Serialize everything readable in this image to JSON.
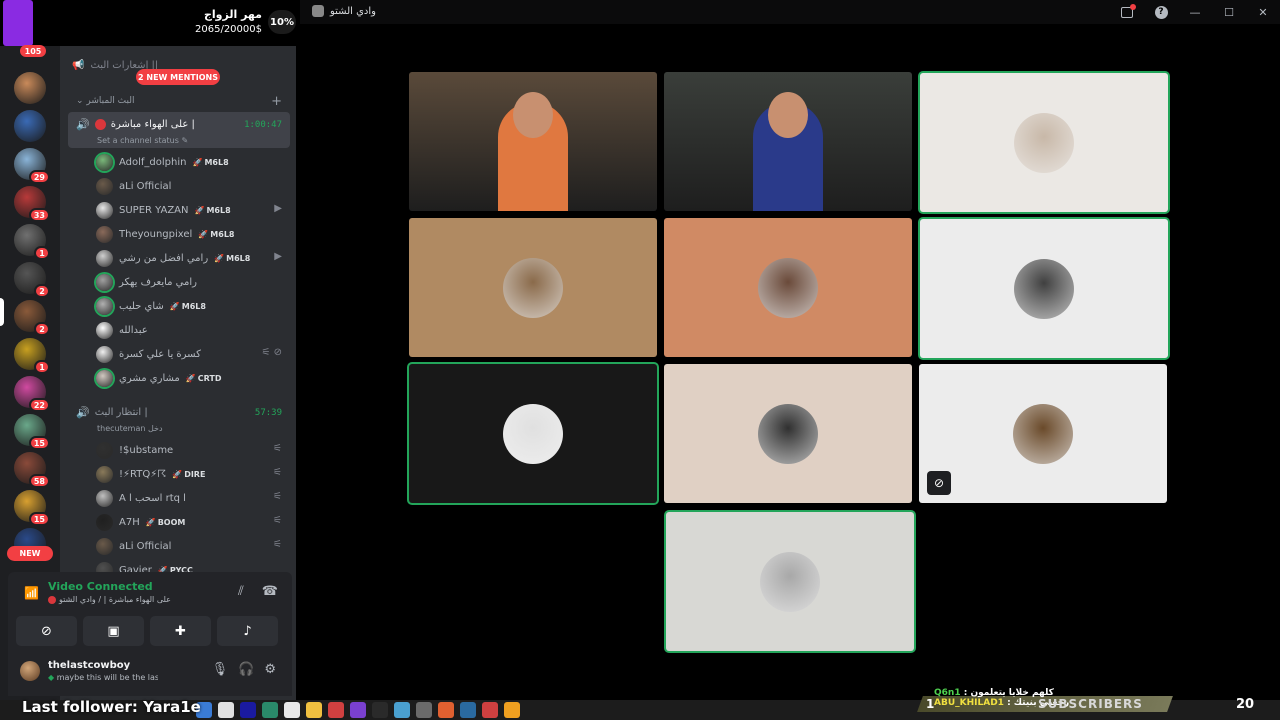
{
  "window": {
    "title": "وادي الشتو"
  },
  "donation": {
    "title": "مهر الزواج",
    "amount": "2065/20000$",
    "percent": "10%"
  },
  "rail": {
    "top_badge": "105",
    "new_label": "NEW",
    "servers": [
      {
        "color": "#c98a5a",
        "badge": ""
      },
      {
        "color": "#3a6ab5",
        "badge": ""
      },
      {
        "color": "#8ab4d8",
        "badge": "29"
      },
      {
        "color": "#b83a3a",
        "badge": "33"
      },
      {
        "color": "#707070",
        "badge": "1"
      },
      {
        "color": "#555555",
        "badge": "2"
      },
      {
        "color": "#8a5a3a",
        "badge": "2"
      },
      {
        "color": "#c8a020",
        "badge": "1"
      },
      {
        "color": "#d04aa0",
        "badge": "22"
      },
      {
        "color": "#6aa88a",
        "badge": "15"
      },
      {
        "color": "#8a4a3a",
        "badge": "58"
      },
      {
        "color": "#d8a030",
        "badge": "15"
      },
      {
        "color": "#2a4a8a",
        "badge": ""
      }
    ]
  },
  "sidebar": {
    "mentions": "2 NEW MENTIONS",
    "announce_channel": "إشعارات البث ||",
    "category": "البث المباشر",
    "live_channel": {
      "name": "على الهواء مباشرة |",
      "timer": "1:00:47",
      "status_placeholder": "Set a channel status"
    },
    "live_users": [
      {
        "name": "Adolf_dolphin",
        "tag": "M6L8",
        "color": "#7ab87a",
        "speaking": true,
        "right": ""
      },
      {
        "name": "aLi Official",
        "tag": "",
        "color": "#6a5a4a",
        "speaking": false,
        "right": ""
      },
      {
        "name": "SUPER YAZAN",
        "tag": "M6L8",
        "color": "#e8e8e8",
        "speaking": false,
        "right": "▶"
      },
      {
        "name": "Theyoungpixel",
        "tag": "M6L8",
        "color": "#8a6a5a",
        "speaking": false,
        "right": ""
      },
      {
        "name": "رامي افضل من رشي",
        "tag": "M6L8",
        "color": "#cfcfcf",
        "speaking": false,
        "right": "▶"
      },
      {
        "name": "رامي مايعرف يهكر",
        "tag": "",
        "color": "#a0a0a0",
        "speaking": true,
        "right": ""
      },
      {
        "name": "شاي حليب",
        "tag": "M6L8",
        "color": "#b0b0b0",
        "speaking": true,
        "right": ""
      },
      {
        "name": "عبدالله",
        "tag": "",
        "color": "#ffffff",
        "speaking": false,
        "right": ""
      },
      {
        "name": "كسرة يا علي كسرة",
        "tag": "",
        "color": "#f0f0f0",
        "speaking": false,
        "right": "⚟ ⊘"
      },
      {
        "name": "مشاري مشري",
        "tag": "CRTD",
        "color": "#d0c8c0",
        "speaking": true,
        "right": ""
      }
    ],
    "waiting_channel": {
      "name": "انتظار البث |",
      "timer": "57:39",
      "status": "thecuteman دخل"
    },
    "waiting_users": [
      {
        "name": "!$ubstame",
        "tag": "",
        "color": "#303030",
        "right": "⚟"
      },
      {
        "name": "!⚡RTQ⚡☈",
        "tag": "DIRE",
        "color": "#8a7a5a",
        "right": "⚟"
      },
      {
        "name": "A l اسحب rtq l",
        "tag": "",
        "color": "#c0c0c0",
        "right": "⚟"
      },
      {
        "name": "A7H",
        "tag": "BOOM",
        "color": "#202020",
        "right": "⚟"
      },
      {
        "name": "aLi Official",
        "tag": "",
        "color": "#6a5a4a",
        "right": "⚟"
      },
      {
        "name": "Gavier",
        "tag": "PYCC",
        "color": "#505050",
        "right": ""
      }
    ]
  },
  "voice": {
    "status": "Video Connected",
    "location": "على الهواء مباشرة | / وادي الشتو",
    "user_name": "thelastcowboy",
    "user_status": "maybe this will be the last"
  },
  "tiles": [
    {
      "kind": "cam",
      "bg": "#5a4a3a",
      "speaking": false,
      "muted": false
    },
    {
      "kind": "cam",
      "bg": "#3a3e3a",
      "speaking": false,
      "muted": false
    },
    {
      "kind": "avatar",
      "bg": "#ebe8e4",
      "avatar": "#c8b8a8",
      "speaking": true,
      "muted": false
    },
    {
      "kind": "avatar",
      "bg": "#b08a62",
      "avatar": "#8a6a4a",
      "speaking": false,
      "muted": false
    },
    {
      "kind": "avatar",
      "bg": "#d08a64",
      "avatar": "#6a4a3a",
      "speaking": false,
      "muted": false
    },
    {
      "kind": "avatar",
      "bg": "#ececec",
      "avatar": "#404040",
      "speaking": true,
      "muted": false
    },
    {
      "kind": "avatar",
      "bg": "#181818",
      "avatar": "#e0e0e0",
      "speaking": true,
      "muted": false
    },
    {
      "kind": "avatar",
      "bg": "#e0d0c4",
      "avatar": "#303030",
      "speaking": false,
      "muted": false
    },
    {
      "kind": "avatar",
      "bg": "#ececec",
      "avatar": "#6a4a2a",
      "speaking": false,
      "muted": true
    },
    {
      "kind": "avatar",
      "bg": "#d8d8d4",
      "avatar": "#a8a8a8",
      "speaking": true,
      "muted": false
    }
  ],
  "overlay": {
    "last_follower": "Last follower: Yara1e",
    "chat_line1_user": "Q6n1",
    "chat_line1_text": ": كلهم خلايا يتعلمون",
    "chat_line2_user": "ABU_KHILAD1",
    "chat_line2_text": ": رجعني بنيتك",
    "subscribers_label": "SUBSCRIBERS",
    "subscribers_count": "20",
    "sub_left_num": "1"
  },
  "colors": {
    "green": "#23a55a",
    "red": "#f23f43",
    "sidebar": "#2b2d31",
    "rail": "#1e1f22"
  }
}
